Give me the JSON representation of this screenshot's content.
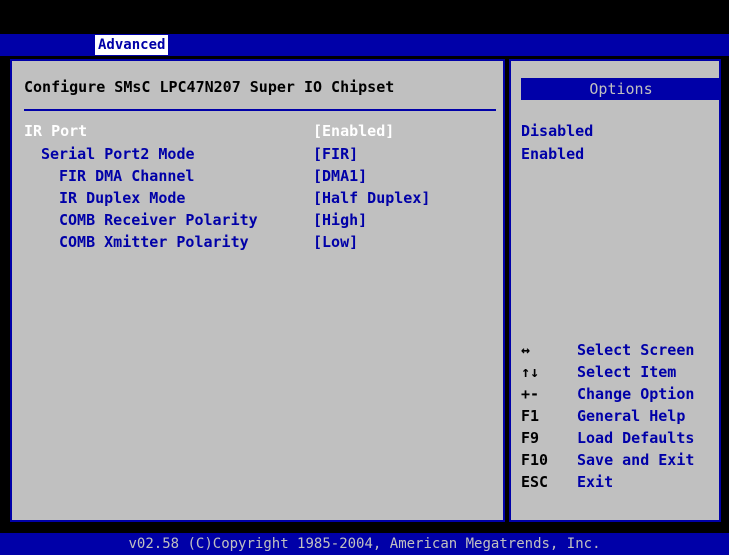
{
  "tabs": [
    {
      "label": "Advanced"
    }
  ],
  "panel": {
    "title": "Configure SMsC LPC47N207 Super IO Chipset"
  },
  "settings": [
    {
      "label": "IR Port",
      "value": "[Enabled]"
    },
    {
      "label": "Serial Port2 Mode",
      "value": "[FIR]"
    },
    {
      "label": "FIR DMA Channel",
      "value": "[DMA1]"
    },
    {
      "label": "IR Duplex Mode",
      "value": "[Half Duplex]"
    },
    {
      "label": "COMB Receiver Polarity",
      "value": "[High]"
    },
    {
      "label": "COMB Xmitter Polarity",
      "value": "[Low]"
    }
  ],
  "options": {
    "header": "Options",
    "items": [
      "Disabled",
      "Enabled"
    ]
  },
  "help": [
    {
      "key": "↔",
      "desc": "Select Screen"
    },
    {
      "key": "↑↓",
      "desc": "Select Item"
    },
    {
      "key": "+-",
      "desc": "Change Option"
    },
    {
      "key": "F1",
      "desc": "General Help"
    },
    {
      "key": "F9",
      "desc": "Load Defaults"
    },
    {
      "key": "F10",
      "desc": "Save and Exit"
    },
    {
      "key": "ESC",
      "desc": "Exit"
    }
  ],
  "footer": {
    "text": "v02.58 (C)Copyright 1985-2004, American Megatrends, Inc."
  },
  "colors": {
    "bios_blue": "#0000a8",
    "panel_gray": "#c0c0c0",
    "highlight_white": "#ffffff"
  }
}
